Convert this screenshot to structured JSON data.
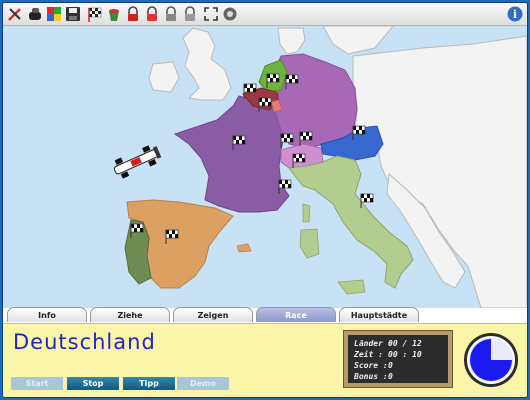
{
  "toolbar": {
    "icons": [
      "tools-icon",
      "gloves-icon",
      "puzzle-icon",
      "save-icon",
      "flag-race-icon",
      "bucket-icon",
      "lock-red-icon",
      "lock-red-2-icon",
      "lock-gray-icon",
      "lock-gray-2-icon",
      "fullscreen-icon",
      "record-icon"
    ],
    "info": "i"
  },
  "tabs": [
    {
      "label": "Info"
    },
    {
      "label": "Ziehe"
    },
    {
      "label": "Zeigen"
    },
    {
      "label": "Race"
    },
    {
      "label": "Hauptstädte"
    }
  ],
  "active_tab": "Race",
  "panel": {
    "country": "Deutschland",
    "buttons": {
      "start": "Start",
      "stop": "Stop",
      "tipp": "Tipp",
      "demo": "Demo"
    }
  },
  "scoreboard": {
    "laender_label": "Länder :",
    "laender_value": "00 / 12",
    "zeit_label": "Zeit :",
    "zeit_value": "00 : 10",
    "score_label": "Score :",
    "score_value": "0",
    "bonus_label": "Bonus :",
    "bonus_value": "0"
  },
  "timer_fraction": 0.25,
  "colors": {
    "sea": "#c8e2f5",
    "land_gray": "#f3f3f3",
    "france": "#8a5ca6",
    "germany": "#a768b6",
    "spain": "#dca062",
    "portugal": "#6f8c52",
    "italy": "#b3cd8f",
    "switzerland": "#cf8fd0",
    "austria": "#3768cf",
    "netherlands": "#6fb33e",
    "belgium": "#9b3846",
    "luxembourg": "#e07d7a",
    "timer_fill": "#1b1bf0"
  }
}
